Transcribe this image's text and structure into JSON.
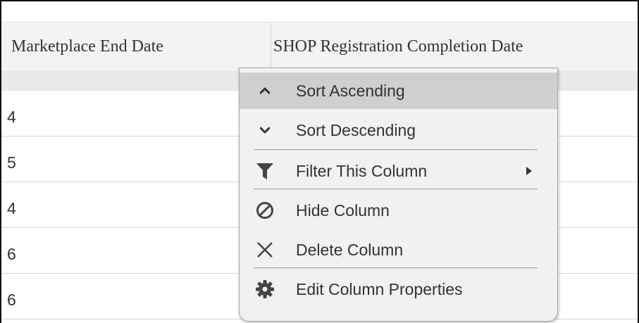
{
  "table": {
    "columns": [
      "Marketplace End Date",
      "SHOP Registration Completion Date"
    ],
    "rows": [
      "4",
      "5",
      "4",
      "6",
      "6"
    ]
  },
  "context_menu": {
    "items": [
      {
        "label": "Sort Ascending",
        "icon": "chevron-up-icon"
      },
      {
        "label": "Sort Descending",
        "icon": "chevron-down-icon"
      },
      {
        "label": "Filter This Column",
        "icon": "filter-icon"
      },
      {
        "label": "Hide Column",
        "icon": "hide-icon"
      },
      {
        "label": "Delete Column",
        "icon": "close-icon"
      },
      {
        "label": "Edit Column Properties",
        "icon": "gear-icon"
      }
    ]
  }
}
